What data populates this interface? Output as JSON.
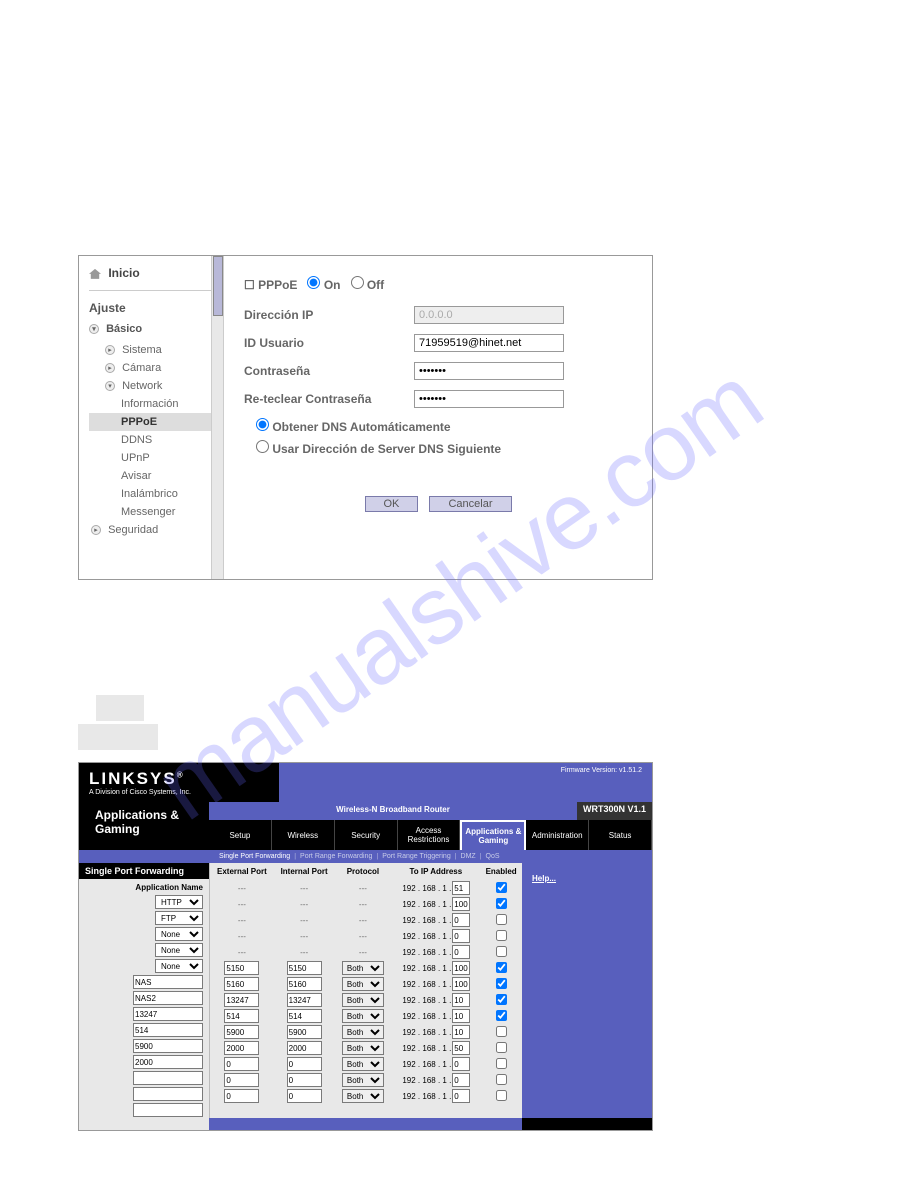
{
  "watermark": "manualshive.com",
  "panel1": {
    "sidebar": {
      "inicio": "Inicio",
      "ajuste": "Ajuste",
      "basico": "Básico",
      "items": [
        {
          "label": "Sistema"
        },
        {
          "label": "Cámara"
        },
        {
          "label": "Network"
        }
      ],
      "subitems": [
        {
          "label": "Información"
        },
        {
          "label": "PPPoE"
        },
        {
          "label": "DDNS"
        },
        {
          "label": "UPnP"
        },
        {
          "label": "Avisar"
        },
        {
          "label": "Inalámbrico"
        },
        {
          "label": "Messenger"
        }
      ],
      "seguridad": "Seguridad"
    },
    "content": {
      "pppoe_label": "PPPoE",
      "on": "On",
      "off": "Off",
      "direccion_ip": "Dirección IP",
      "direccion_ip_val": "0.0.0.0",
      "id_usuario": "ID Usuario",
      "id_usuario_val": "71959519@hinet.net",
      "contrasena": "Contraseña",
      "contrasena_val": "•••••••",
      "reteclear": "Re-teclear Contraseña",
      "reteclear_val": "•••••••",
      "dns_auto": "Obtener DNS Automáticamente",
      "dns_manual": "Usar Dirección de Server DNS Siguiente",
      "ok": "OK",
      "cancelar": "Cancelar"
    }
  },
  "panel2": {
    "brand": "LINKSYS",
    "brand_sub": "A Division of Cisco Systems, Inc.",
    "firmware": "Firmware Version: v1.51.2",
    "model_title": "Wireless-N Broadband Router",
    "model": "WRT300N V1.1",
    "page_title1": "Applications &",
    "page_title2": "Gaming",
    "tabs": [
      "Setup",
      "Wireless",
      "Security",
      "Access Restrictions",
      "Applications & Gaming",
      "Administration",
      "Status"
    ],
    "subnav": [
      "Single Port Forwarding",
      "Port Range Forwarding",
      "Port Range Triggering",
      "DMZ",
      "QoS"
    ],
    "left": {
      "header": "Single Port Forwarding",
      "app_name": "Application Name",
      "selects": [
        "HTTP",
        "FTP",
        "None",
        "None",
        "None"
      ],
      "inputs": [
        "NAS",
        "NAS2",
        "13247",
        "514",
        "5900",
        "2000",
        "",
        "",
        ""
      ]
    },
    "table": {
      "headers": [
        "External Port",
        "Internal Port",
        "Protocol",
        "To IP Address",
        "Enabled"
      ],
      "ip_prefix": "192 . 168 . 1 .",
      "preset_rows": [
        {
          "ip": "51",
          "checked": true
        },
        {
          "ip": "100",
          "checked": true
        },
        {
          "ip": "0",
          "checked": false
        },
        {
          "ip": "0",
          "checked": false
        },
        {
          "ip": "0",
          "checked": false
        }
      ],
      "custom_rows": [
        {
          "ext": "5150",
          "int": "5150",
          "proto": "Both",
          "ip": "100",
          "checked": true
        },
        {
          "ext": "5160",
          "int": "5160",
          "proto": "Both",
          "ip": "100",
          "checked": true
        },
        {
          "ext": "13247",
          "int": "13247",
          "proto": "Both",
          "ip": "10",
          "checked": true
        },
        {
          "ext": "514",
          "int": "514",
          "proto": "Both",
          "ip": "10",
          "checked": true
        },
        {
          "ext": "5900",
          "int": "5900",
          "proto": "Both",
          "ip": "10",
          "checked": false
        },
        {
          "ext": "2000",
          "int": "2000",
          "proto": "Both",
          "ip": "50",
          "checked": false
        },
        {
          "ext": "0",
          "int": "0",
          "proto": "Both",
          "ip": "0",
          "checked": false
        },
        {
          "ext": "0",
          "int": "0",
          "proto": "Both",
          "ip": "0",
          "checked": false
        },
        {
          "ext": "0",
          "int": "0",
          "proto": "Both",
          "ip": "0",
          "checked": false
        }
      ]
    },
    "help": "Help..."
  }
}
